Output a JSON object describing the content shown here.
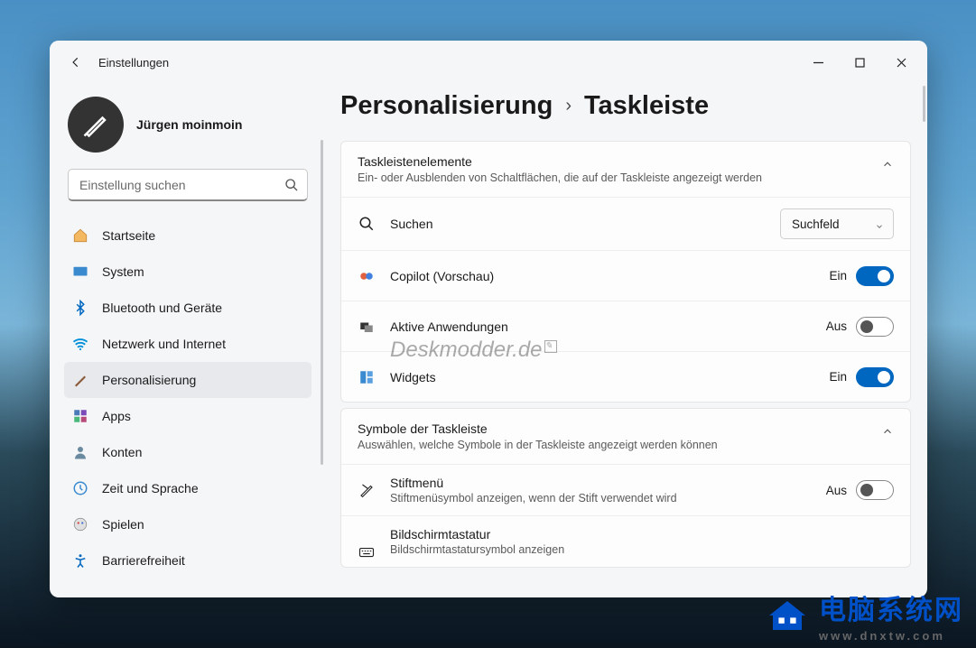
{
  "app": {
    "title": "Einstellungen"
  },
  "user": {
    "name": "Jürgen moinmoin"
  },
  "search": {
    "placeholder": "Einstellung suchen"
  },
  "nav": {
    "items": [
      {
        "label": "Startseite"
      },
      {
        "label": "System"
      },
      {
        "label": "Bluetooth und Geräte"
      },
      {
        "label": "Netzwerk und Internet"
      },
      {
        "label": "Personalisierung"
      },
      {
        "label": "Apps"
      },
      {
        "label": "Konten"
      },
      {
        "label": "Zeit und Sprache"
      },
      {
        "label": "Spielen"
      },
      {
        "label": "Barrierefreiheit"
      }
    ]
  },
  "breadcrumb": {
    "parent": "Personalisierung",
    "leaf": "Taskleiste"
  },
  "sections": {
    "taskbar_items": {
      "title": "Taskleistenelemente",
      "subtitle": "Ein- oder Ausblenden von Schaltflächen, die auf der Taskleiste angezeigt werden",
      "rows": {
        "search": {
          "label": "Suchen",
          "select_value": "Suchfeld"
        },
        "copilot": {
          "label": "Copilot (Vorschau)",
          "state": "Ein"
        },
        "taskview": {
          "label": "Aktive Anwendungen",
          "state": "Aus"
        },
        "widgets": {
          "label": "Widgets",
          "state": "Ein"
        }
      }
    },
    "tray_icons": {
      "title": "Symbole der Taskleiste",
      "subtitle": "Auswählen, welche Symbole in der Taskleiste angezeigt werden können",
      "rows": {
        "pen": {
          "label": "Stiftmenü",
          "sub": "Stiftmenüsymbol anzeigen, wenn der Stift verwendet wird",
          "state": "Aus"
        },
        "osk": {
          "label": "Bildschirmtastatur",
          "sub": "Bildschirmtastatursymbol anzeigen"
        }
      }
    }
  },
  "watermark": "Deskmodder.de",
  "footer": {
    "cn": "电脑系统网",
    "url": "www.dnxtw.com"
  }
}
